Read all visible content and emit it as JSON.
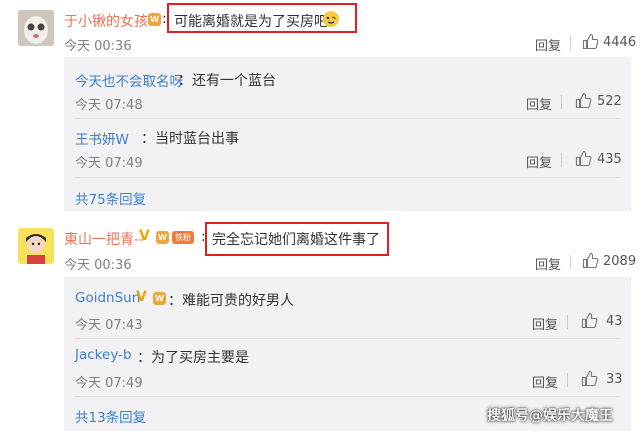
{
  "comments": [
    {
      "author": "于小锹的女孩",
      "text": "可能离婚就是为了买房吧",
      "time": "今天 00:36",
      "reply_label": "回复",
      "likes": "4446",
      "replies": [
        {
          "author": "今天也不会取名呀",
          "text": "：还有一个蓝台",
          "time": "今天 07:48",
          "reply_label": "回复",
          "likes": "522"
        },
        {
          "author": "王书妍W",
          "text": "：当时蓝台出事",
          "time": "今天 07:49",
          "reply_label": "回复",
          "likes": "435"
        }
      ],
      "more_replies": "共75条回复"
    },
    {
      "author": "東山一把青--",
      "text": "完全忘记她们离婚这件事了",
      "time": "今天 00:36",
      "reply_label": "回复",
      "likes": "2089",
      "replies": [
        {
          "author": "GoidnSun",
          "text": "：难能可贵的好男人",
          "time": "今天 07:43",
          "reply_label": "回复",
          "likes": "43"
        },
        {
          "author": "Jackey-b",
          "text": "：为了买房主要是",
          "time": "今天 07:49",
          "reply_label": "回复",
          "likes": "33"
        }
      ],
      "more_replies": "共13条回复"
    }
  ],
  "watermark": "搜狐号@娱乐大魔王",
  "colors": {
    "author": "#eb7350",
    "link": "#3d7fcc",
    "highlight": "#e02020"
  }
}
